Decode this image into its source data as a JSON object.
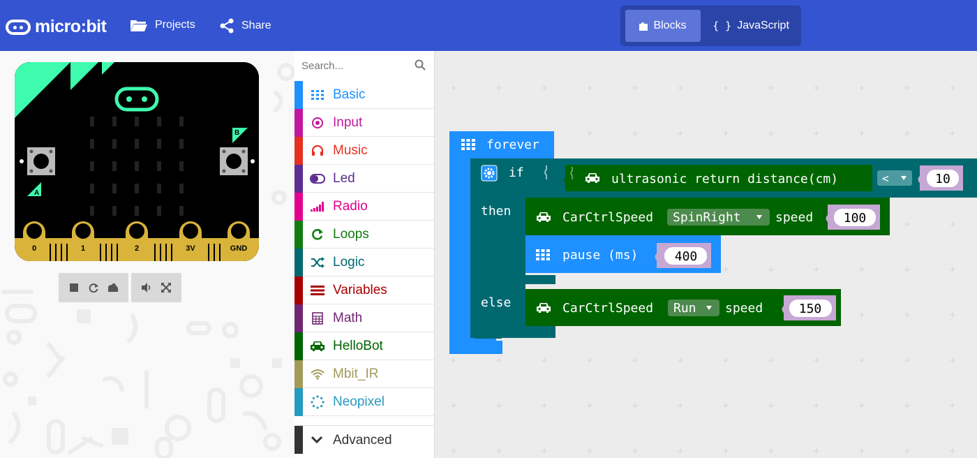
{
  "header": {
    "brand": "micro:bit",
    "projects_label": "Projects",
    "share_label": "Share",
    "modes": {
      "blocks_label": "Blocks",
      "javascript_label": "JavaScript",
      "active": "Blocks"
    }
  },
  "simulator": {
    "buttons": {
      "a": "A",
      "b": "B"
    },
    "pins": [
      "0",
      "1",
      "2",
      "3V",
      "GND"
    ],
    "controls": [
      "stop-icon",
      "restart-icon",
      "debug-icon",
      "mute-icon",
      "fullscreen-icon"
    ]
  },
  "toolbox": {
    "search_placeholder": "Search...",
    "categories": [
      {
        "label": "Basic",
        "color": "#1e90ff",
        "icon": "grid-icon"
      },
      {
        "label": "Input",
        "color": "#c2189e",
        "icon": "target-icon"
      },
      {
        "label": "Music",
        "color": "#e63022",
        "icon": "headphones-icon"
      },
      {
        "label": "Led",
        "color": "#5c2d91",
        "icon": "toggle-icon"
      },
      {
        "label": "Radio",
        "color": "#e3008c",
        "icon": "signal-icon"
      },
      {
        "label": "Loops",
        "color": "#107c10",
        "icon": "refresh-icon"
      },
      {
        "label": "Logic",
        "color": "#006970",
        "icon": "shuffle-icon"
      },
      {
        "label": "Variables",
        "color": "#a80000",
        "icon": "list-icon"
      },
      {
        "label": "Math",
        "color": "#712672",
        "icon": "calculator-icon"
      },
      {
        "label": "HelloBot",
        "color": "#006400",
        "icon": "car-icon"
      },
      {
        "label": "Mbit_IR",
        "color": "#a39a5a",
        "icon": "wifi-icon"
      },
      {
        "label": "Neopixel",
        "color": "#2699bf",
        "icon": "dotted-circle-icon"
      }
    ],
    "advanced_label": "Advanced"
  },
  "workspace": {
    "forever_label": "forever",
    "if_label": "if",
    "then_label": "then",
    "else_label": "else",
    "condition": {
      "sensor_label": "ultrasonic return distance(cm)",
      "operator": "<",
      "value": "10"
    },
    "then_blocks": {
      "car_label": "CarCtrlSpeed",
      "direction": "SpinRight",
      "speed_label": "speed",
      "speed_value": "100",
      "pause_label": "pause (ms)",
      "pause_value": "400"
    },
    "else_block": {
      "car_label": "CarCtrlSpeed",
      "direction": "Run",
      "speed_label": "speed",
      "speed_value": "150"
    },
    "colors": {
      "basic": "#1e90ff",
      "logic": "#006970",
      "hellobot": "#006400",
      "number_bg": "#c6a8d4"
    }
  }
}
